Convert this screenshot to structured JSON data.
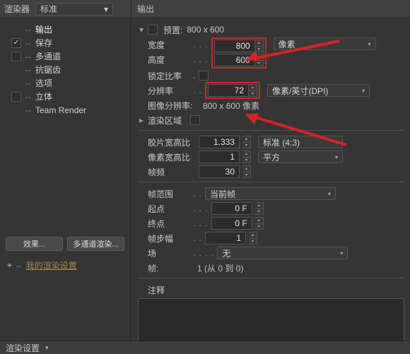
{
  "topbar": {
    "renderer_static": "渲染器",
    "renderer_value": "标准",
    "output_header": "输出"
  },
  "tree": {
    "items": [
      {
        "label": "输出",
        "checked": null,
        "selected": true
      },
      {
        "label": "保存",
        "checked": true,
        "selected": false
      },
      {
        "label": "多通道",
        "checked": false,
        "selected": false
      },
      {
        "label": "抗锯齿",
        "checked": null,
        "selected": false
      },
      {
        "label": "选项",
        "checked": null,
        "selected": false
      },
      {
        "label": "立体",
        "checked": false,
        "selected": false
      },
      {
        "label": "Team Render",
        "checked": null,
        "selected": false
      }
    ]
  },
  "left_buttons": {
    "effects": "效果...",
    "multipass": "多通道渲染..."
  },
  "my_settings": {
    "label": "我的渲染设置"
  },
  "params": {
    "preset_label": "预置:",
    "preset_value": "800 x 600",
    "width_label": "宽度",
    "width_value": "800",
    "pixel_unit": "像素",
    "height_label": "高度",
    "height_value": "600",
    "lock_label": "锁定比率",
    "lock_value": false,
    "res_label": "分辨率",
    "res_value": "72",
    "res_unit": "像素/英寸(DPI)",
    "imgres_label": "图像分辨率:",
    "imgres_value": "800 x 600 像素",
    "render_region_label": "渲染区域",
    "render_region_value": false,
    "film_label": "胶片宽高比",
    "film_value": "1.333",
    "film_unit": "标准 (4:3)",
    "pixel_aspect_label": "像素宽高比",
    "pixel_aspect_value": "1",
    "pixel_aspect_unit": "平方",
    "fps_label": "帧频",
    "fps_value": "30",
    "range_label": "帧范围",
    "range_value": "当前帧",
    "from_label": "起点",
    "from_value": "0 F",
    "to_label": "终点",
    "to_value": "0 F",
    "step_label": "帧步幅",
    "step_value": "1",
    "field_label": "场",
    "field_value": "无",
    "frames_label": "帧:",
    "frames_value": "1 (从 0 到 0)",
    "notes_label": "注释"
  },
  "footer": {
    "render_settings": "渲染设置"
  }
}
